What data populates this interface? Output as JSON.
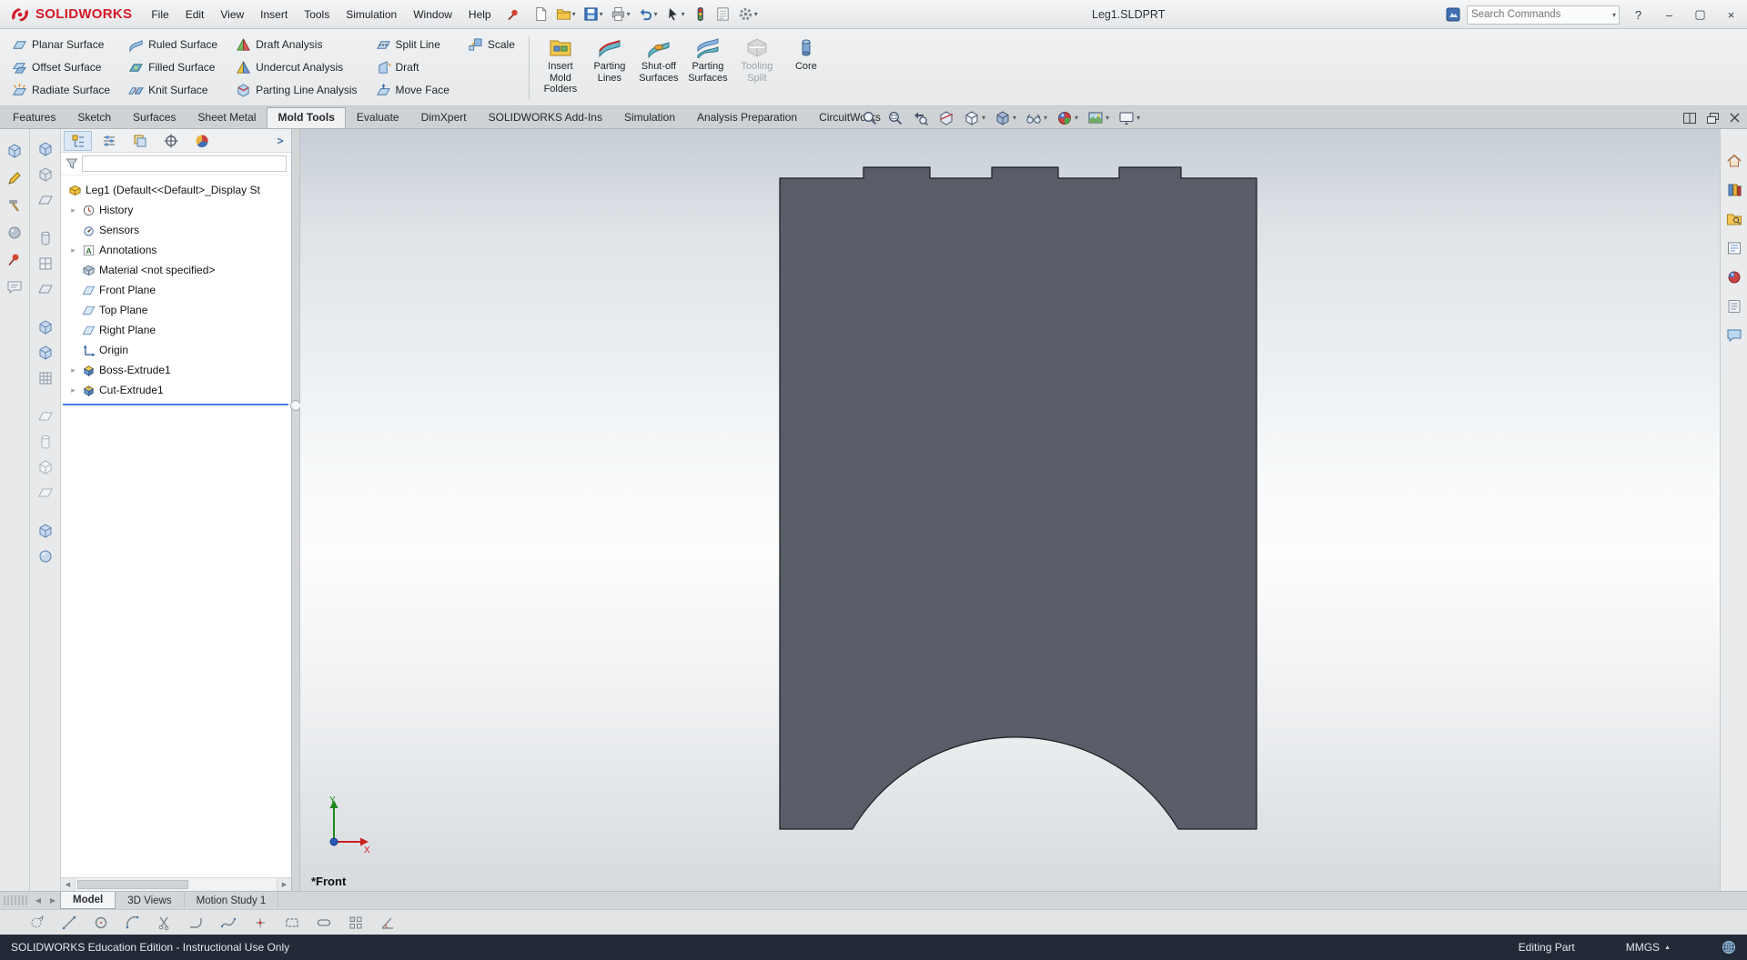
{
  "titlebar": {
    "app_name": "SOLIDWORKS",
    "menus": [
      "File",
      "Edit",
      "View",
      "Insert",
      "Tools",
      "Simulation",
      "Window",
      "Help"
    ],
    "document_title": "Leg1.SLDPRT",
    "search_placeholder": "Search Commands",
    "help_label": "?",
    "minimize_glyph": "–",
    "maximize_glyph": "▢",
    "close_glyph": "×"
  },
  "ribbon": {
    "planar_surface": "Planar Surface",
    "offset_surface": "Offset Surface",
    "radiate_surface": "Radiate Surface",
    "ruled_surface": "Ruled Surface",
    "filled_surface": "Filled Surface",
    "knit_surface": "Knit Surface",
    "draft_analysis": "Draft Analysis",
    "undercut_analysis": "Undercut Analysis",
    "parting_line_analysis": "Parting Line Analysis",
    "split_line": "Split Line",
    "draft": "Draft",
    "move_face": "Move Face",
    "scale": "Scale",
    "insert_mold_folders": "Insert Mold Folders",
    "parting_lines": "Parting Lines",
    "shut_off_surfaces": "Shut-off Surfaces",
    "parting_surfaces": "Parting Surfaces",
    "tooling_split": "Tooling Split",
    "core": "Core"
  },
  "command_tabs": [
    "Features",
    "Sketch",
    "Surfaces",
    "Sheet Metal",
    "Mold Tools",
    "Evaluate",
    "DimXpert",
    "SOLIDWORKS Add-Ins",
    "Simulation",
    "Analysis Preparation",
    "CircuitWorks"
  ],
  "feature_tree": {
    "root_label": "Leg1 (Default<<Default>_Display St",
    "items": [
      {
        "label": "History"
      },
      {
        "label": "Sensors"
      },
      {
        "label": "Annotations"
      },
      {
        "label": "Material <not specified>"
      },
      {
        "label": "Front Plane"
      },
      {
        "label": "Top Plane"
      },
      {
        "label": "Right Plane"
      },
      {
        "label": "Origin"
      },
      {
        "label": "Boss-Extrude1"
      },
      {
        "label": "Cut-Extrude1"
      }
    ]
  },
  "graphics": {
    "view_label": "*Front",
    "part_color": "#585d68",
    "part_outline": "#1a1c20"
  },
  "bottom_bar": {
    "doc_tabs": [
      "Model",
      "3D Views",
      "Motion Study 1"
    ]
  },
  "status_bar": {
    "left_text": "SOLIDWORKS Education Edition - Instructional Use Only",
    "mode": "Editing Part",
    "units": "MMGS"
  }
}
